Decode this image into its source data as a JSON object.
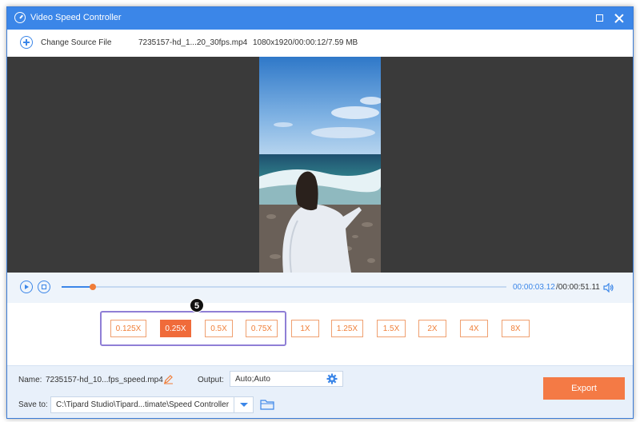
{
  "window": {
    "title": "Video Speed Controller"
  },
  "filebar": {
    "change_source_label": "Change Source File",
    "filename": "7235157-hd_1...20_30fps.mp4",
    "fileinfo": "1080x1920/00:00:12/7.59 MB"
  },
  "player": {
    "current_time": "00:00:03.12",
    "total_time": "/00:00:51.11",
    "progress": 0.07
  },
  "speeds": {
    "step_badge": "5",
    "options": [
      "0.125X",
      "0.25X",
      "0.5X",
      "0.75X",
      "1X",
      "1.25X",
      "1.5X",
      "2X",
      "4X",
      "8X"
    ],
    "selected": "0.25X"
  },
  "bottom": {
    "name_label": "Name:",
    "name_value": "7235157-hd_10...fps_speed.mp4",
    "output_label": "Output:",
    "output_value": "Auto;Auto",
    "save_label": "Save to:",
    "save_path": "C:\\Tipard Studio\\Tipard...timate\\Speed Controller",
    "export_label": "Export"
  },
  "colors": {
    "accent": "#3b86e8",
    "highlight": "#f06b3a",
    "export": "#f47a45"
  }
}
